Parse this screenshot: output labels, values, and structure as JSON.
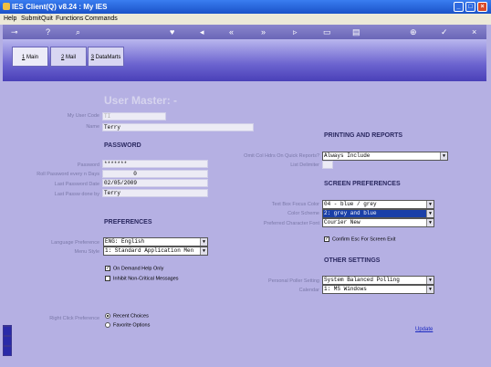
{
  "window": {
    "title": "IES Client(Q) v8.24 : My IES"
  },
  "menu": {
    "help": "Help",
    "submit": "Submit",
    "quit": "Quit",
    "functions": "Functions",
    "commands": "Commands"
  },
  "tabs": [
    {
      "num": "1",
      "label": " Main"
    },
    {
      "num": "2",
      "label": " Mail"
    },
    {
      "num": "3",
      "label": " DataMarts"
    }
  ],
  "form": {
    "title": "User Master: -",
    "user_code_label": "My User Code",
    "user_code": "TI",
    "name_label": "Name",
    "name": "Terry",
    "password_heading": "PASSWORD",
    "password_label": "Password",
    "password": "*******",
    "roll_label": "Roll Password every n Days",
    "roll": "0",
    "last_pw_date_label": "Last Password Date",
    "last_pw_date": "02/05/2009",
    "last_pw_by_label": "Last Passw done by",
    "last_pw_by": "Terry",
    "preferences_heading": "PREFERENCES",
    "language_label": "Language Preference",
    "language": "ENG: English",
    "menu_style_label": "Menu Style",
    "menu_style": "1: Standard Application Men",
    "on_demand_help": "On Demand Help Only",
    "inhibit_msgs": "Inhibit Non-Critical Messages",
    "right_click_label": "Right Click Preference",
    "recent_choices": "Recent Choices",
    "favorite_options": "Favorite Options",
    "printing_heading": "PRINTING AND REPORTS",
    "omit_col_label": "Omit Col Hdrs On Quick Reports?",
    "omit_col": "Always Include",
    "list_delimiter_label": "List Delimiter",
    "list_delimiter": "",
    "screen_heading": "SCREEN PREFERENCES",
    "text_box_label": "Text Box Focus Color",
    "text_box": "04 - blue / grey",
    "color_scheme_label": "Color Scheme",
    "color_scheme": "2: grey and blue",
    "char_font_label": "Preferred Character Font",
    "char_font": "Courier New",
    "confirm_esc": "Confirm Esc For Screen Exit",
    "other_heading": "OTHER SETTINGS",
    "poller_label": "Personal Poller Setting",
    "poller": "System Balanced Polling",
    "calendar_label": "Calendar",
    "calendar": "1: MS Windows",
    "update": "Update"
  }
}
